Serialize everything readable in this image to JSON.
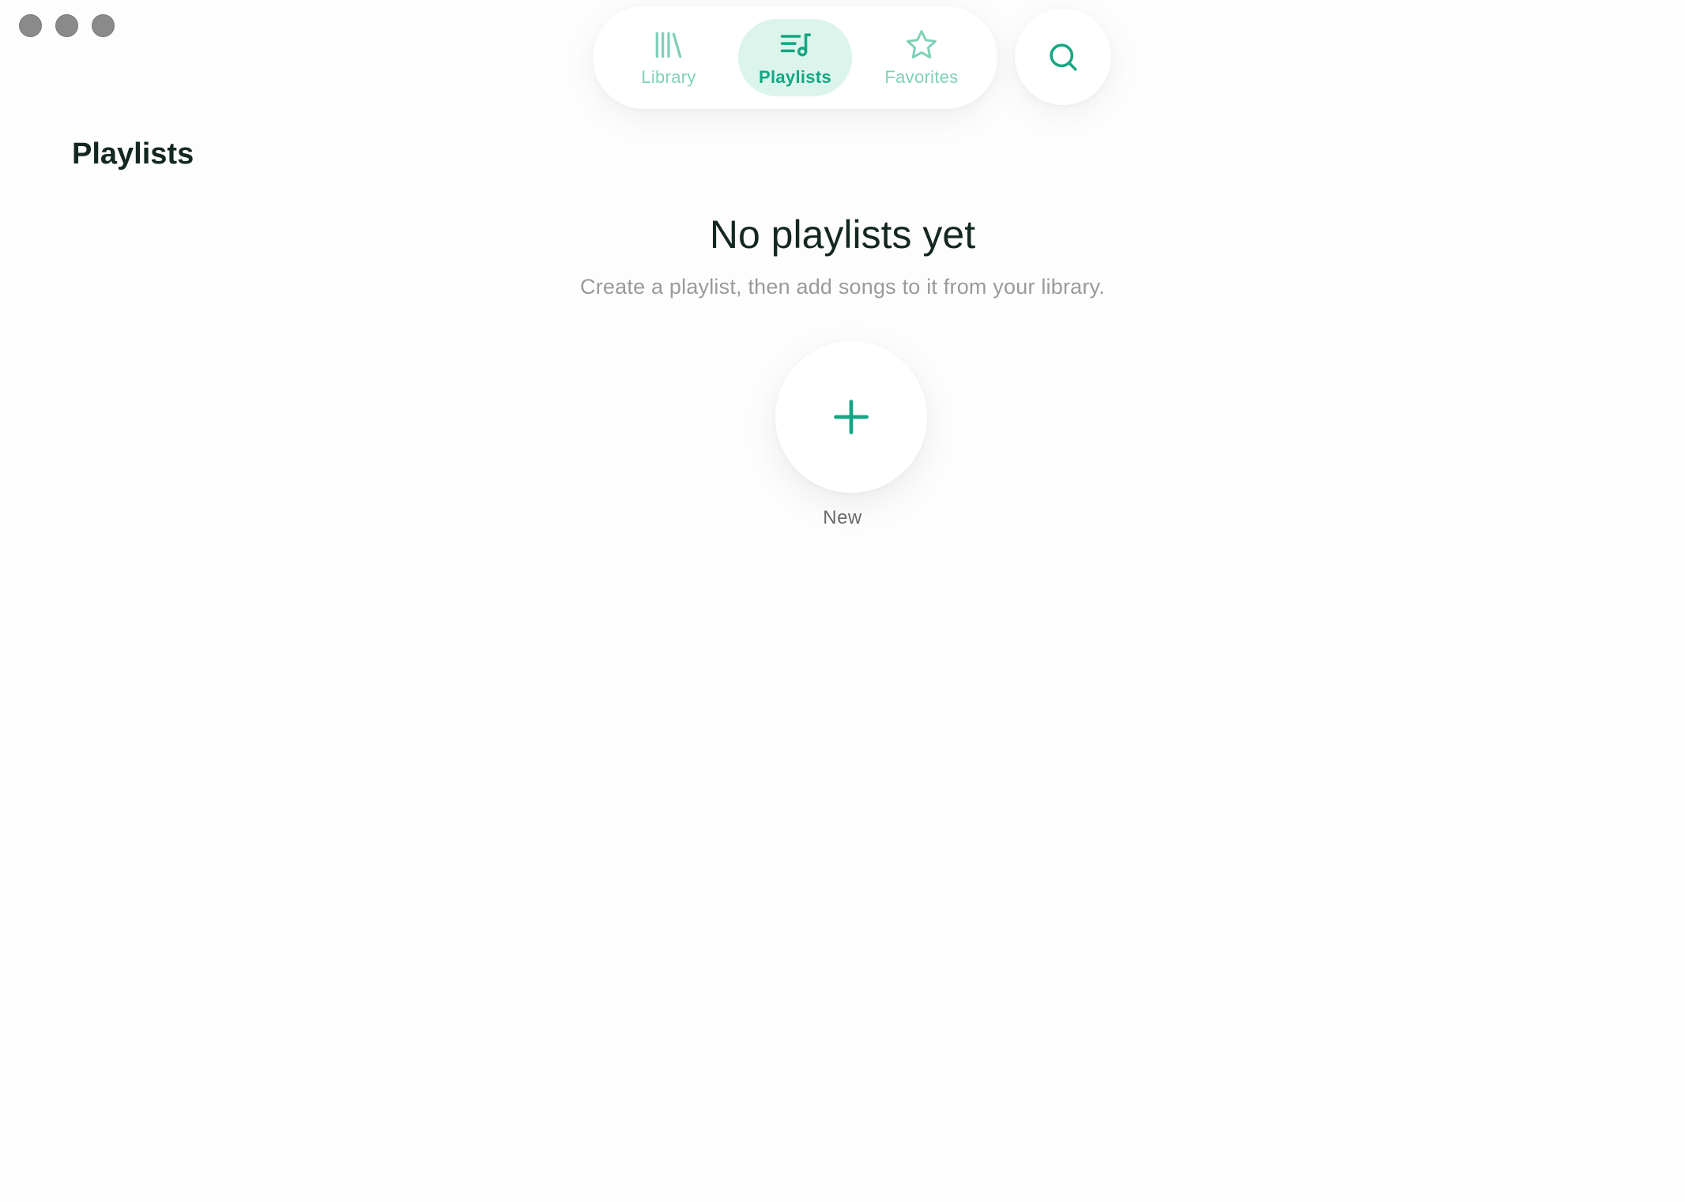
{
  "window": {
    "traffic_lights": [
      "close",
      "minimize",
      "zoom"
    ]
  },
  "nav": {
    "tabs": [
      {
        "label": "Library",
        "icon": "library-icon",
        "active": false
      },
      {
        "label": "Playlists",
        "icon": "playlist-icon",
        "active": true
      },
      {
        "label": "Favorites",
        "icon": "star-icon",
        "active": false
      }
    ],
    "search_icon": "search-icon"
  },
  "page": {
    "title": "Playlists"
  },
  "empty_state": {
    "title": "No playlists yet",
    "subtitle": "Create a playlist, then add songs to it from your library.",
    "new_icon": "plus-icon",
    "new_label": "New"
  },
  "colors": {
    "accent": "#14a683",
    "accent_light": "#7fd0b9",
    "active_tab_bg": "#dbf5ec",
    "traffic_light": "#8a8a8a"
  }
}
